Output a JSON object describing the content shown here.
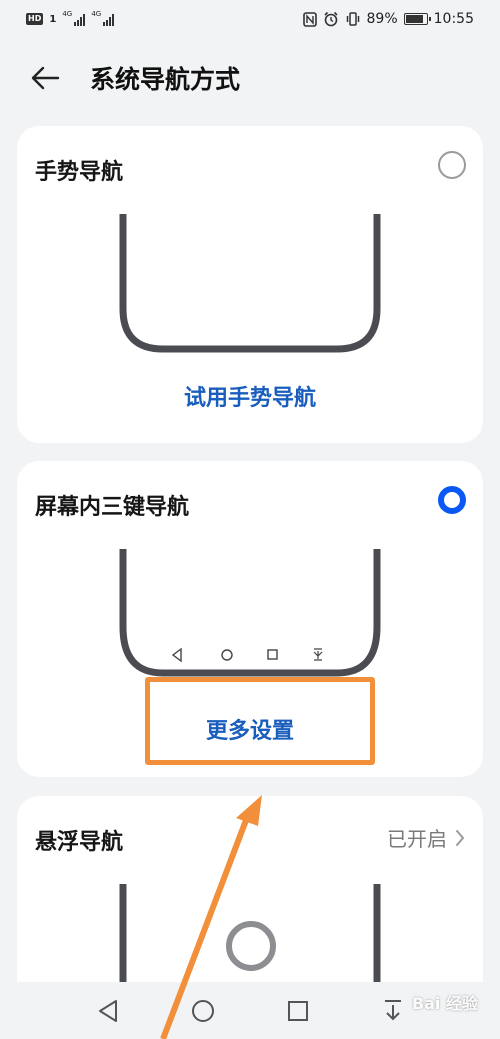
{
  "status_bar": {
    "hd": "HD",
    "sim": "1",
    "net1": "4G",
    "net2": "4G",
    "battery": "89%",
    "time": "10:55",
    "battery_level": 0.89
  },
  "header": {
    "title": "系统导航方式"
  },
  "gesture_card": {
    "title": "手势导航",
    "link": "试用手势导航",
    "selected": false
  },
  "threekey_card": {
    "title": "屏幕内三键导航",
    "link": "更多设置",
    "selected": true
  },
  "float_card": {
    "title": "悬浮导航",
    "status": "已开启"
  },
  "watermark": "Bai 经验",
  "colors": {
    "accent": "#0a59f7",
    "link": "#1a5ebd",
    "highlight": "#f28f3b",
    "phone_frame": "#4a4c52"
  }
}
